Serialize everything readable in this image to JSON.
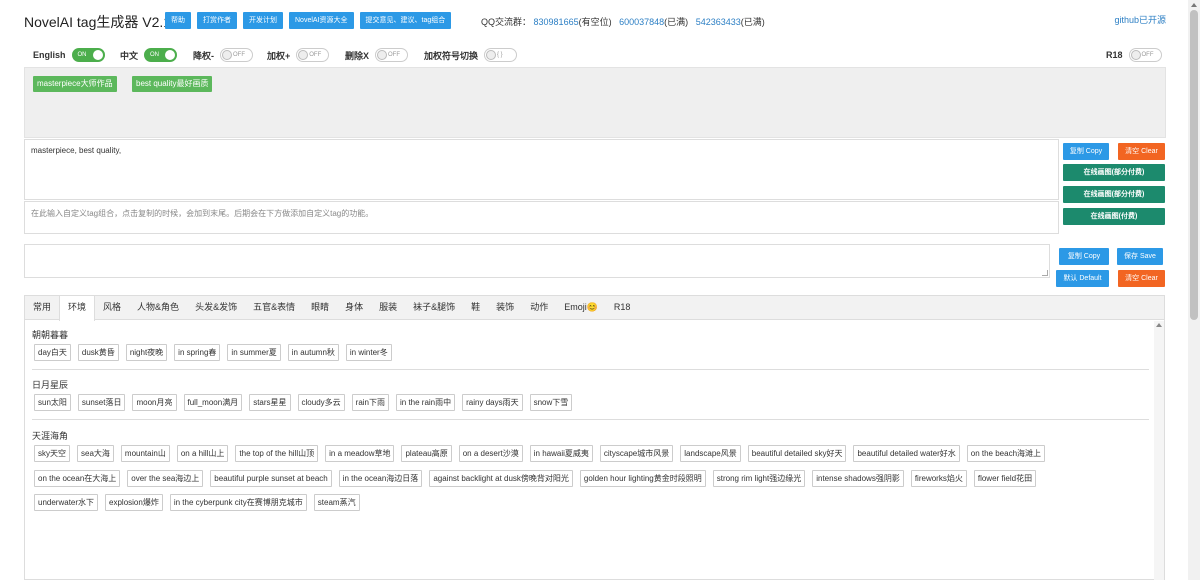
{
  "header": {
    "title": "NovelAI tag生成器 V2.1",
    "buttons": [
      "帮助",
      "打赏作者",
      "开发计划",
      "NovelAI资源大全",
      "提交意见、建议、tag组合"
    ],
    "qq_label": "QQ交流群：",
    "qq_groups": [
      {
        "number": "830981665",
        "status": "(有空位)"
      },
      {
        "number": "600037848",
        "status": "(已满)"
      },
      {
        "number": "542363433",
        "status": "(已满)"
      }
    ],
    "github": "github已开源"
  },
  "toggles": [
    {
      "label": "English",
      "state": "ON"
    },
    {
      "label": "中文",
      "state": "ON"
    },
    {
      "label": "降权-",
      "state": "OFF"
    },
    {
      "label": "加权+",
      "state": "OFF"
    },
    {
      "label": "删除X",
      "state": "OFF"
    },
    {
      "label": "加权符号切换",
      "state": "{ }"
    }
  ],
  "r18": {
    "label": "R18",
    "state": "OFF"
  },
  "selected_tags": [
    "masterpiece大师作品",
    "best quality最好画质"
  ],
  "output_text": "masterpiece, best quality,",
  "custom_placeholder": "在此输入自定义tag组合，点击复制的时候，会加到末尾。后期会在下方做添加自定义tag的功能。",
  "right_buttons": {
    "copy": "复制 Copy",
    "clear": "清空 Clear",
    "draw1": "在线画图(部分付费)",
    "draw2": "在线画图(部分付费)",
    "draw3": "在线画图(付费)",
    "copy2": "复制 Copy",
    "save": "保存 Save",
    "default": "默认 Default",
    "clear2": "清空 Clear"
  },
  "tabs": [
    "常用",
    "环境",
    "风格",
    "人物&角色",
    "头发&发饰",
    "五官&表情",
    "眼睛",
    "身体",
    "服装",
    "袜子&腿饰",
    "鞋",
    "装饰",
    "动作",
    "Emoji😊",
    "R18"
  ],
  "sections": [
    {
      "title": "朝朝暮暮",
      "rows": [
        [
          "day白天",
          "dusk黄昏",
          "night夜晚",
          "in spring春",
          "in summer夏",
          "in autumn秋",
          "in winter冬"
        ]
      ]
    },
    {
      "title": "日月星辰",
      "rows": [
        [
          "sun太阳",
          "sunset落日",
          "moon月亮",
          "full_moon满月",
          "stars星星",
          "cloudy多云",
          "rain下雨",
          "in the rain雨中",
          "rainy days雨天",
          "snow下雪"
        ]
      ]
    },
    {
      "title": "天涯海角",
      "rows": [
        [
          "sky天空",
          "sea大海",
          "mountain山",
          "on a hill山上",
          "the top of the hill山顶",
          "in a meadow草地",
          "plateau高原",
          "on a desert沙漠",
          "in hawaii夏威夷",
          "cityscape城市风景",
          "landscape风景",
          "beautiful detailed sky好天",
          "beautiful detailed water好水",
          "on the beach海滩上"
        ],
        [
          "on the ocean在大海上",
          "over the sea海边上",
          "beautiful purple sunset at beach",
          "in the ocean海边日落",
          "against backlight at dusk傍晚背对阳光",
          "golden hour lighting黄金时段照明",
          "strong rim light强边缘光",
          "intense shadows强阴影",
          "fireworks焰火",
          "flower field花田"
        ],
        [
          "underwater水下",
          "explosion爆炸",
          "in the cyberpunk city在赛博朋克城市",
          "steam蒸汽"
        ]
      ]
    }
  ]
}
